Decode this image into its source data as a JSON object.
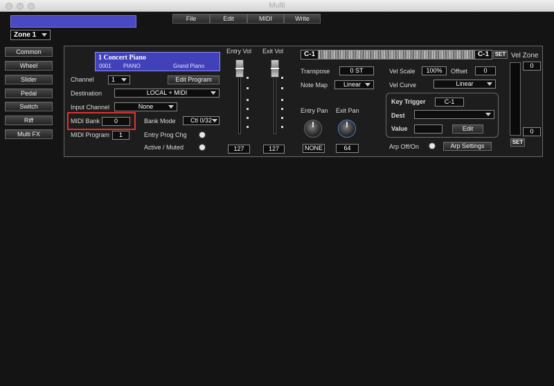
{
  "window": {
    "title": "Multi"
  },
  "menu": {
    "file": "File",
    "edit": "Edit",
    "midi": "MIDI",
    "write": "Write"
  },
  "zone_select": {
    "value": "Zone 1"
  },
  "sidebar": {
    "items": [
      "Common",
      "Wheel",
      "Slider",
      "Pedal",
      "Switch",
      "Riff",
      "Multi FX"
    ]
  },
  "program": {
    "number_name": "1   Concert Piano",
    "id": "0001",
    "category": "PIANO",
    "type": "Grand Piano"
  },
  "channel": {
    "label": "Channel",
    "value": "1"
  },
  "edit_program": "Edit Program",
  "destination": {
    "label": "Destination",
    "value": "LOCAL + MIDI"
  },
  "input_channel": {
    "label": "Input Channel",
    "value": "None"
  },
  "midi_bank": {
    "label": "MIDI Bank",
    "value": "0"
  },
  "bank_mode": {
    "label": "Bank Mode",
    "value": "Ctl 0/32"
  },
  "midi_program": {
    "label": "MIDI Program",
    "value": "1"
  },
  "entry_prog_chg": {
    "label": "Entry Prog Chg"
  },
  "active_muted": {
    "label": "Active / Muted"
  },
  "entry_vol": {
    "label": "Entry Vol",
    "value": "127"
  },
  "exit_vol": {
    "label": "Exit Vol",
    "value": "127"
  },
  "key_range": {
    "low": "C-1",
    "high": "C-1",
    "set": "SET"
  },
  "transpose": {
    "label": "Transpose",
    "value": "0 ST"
  },
  "note_map": {
    "label": "Note Map",
    "value": "Linear"
  },
  "entry_pan": {
    "label": "Entry Pan",
    "value": "NONE"
  },
  "exit_pan": {
    "label": "Exit Pan",
    "value": "64"
  },
  "vel_scale": {
    "label": "Vel Scale",
    "value": "100%"
  },
  "offset": {
    "label": "Offset",
    "value": "0"
  },
  "vel_curve": {
    "label": "Vel Curve",
    "value": "Linear"
  },
  "key_trigger": {
    "label": "Key Trigger",
    "value": "C-1",
    "dest_label": "Dest",
    "dest_value": "",
    "value_label": "Value",
    "value_value": "",
    "edit": "Edit"
  },
  "arp": {
    "label": "Arp Off/On",
    "settings": "Arp Settings"
  },
  "vel_zone": {
    "label": "Vel Zone",
    "top": "0",
    "bottom": "0",
    "set": "SET"
  }
}
